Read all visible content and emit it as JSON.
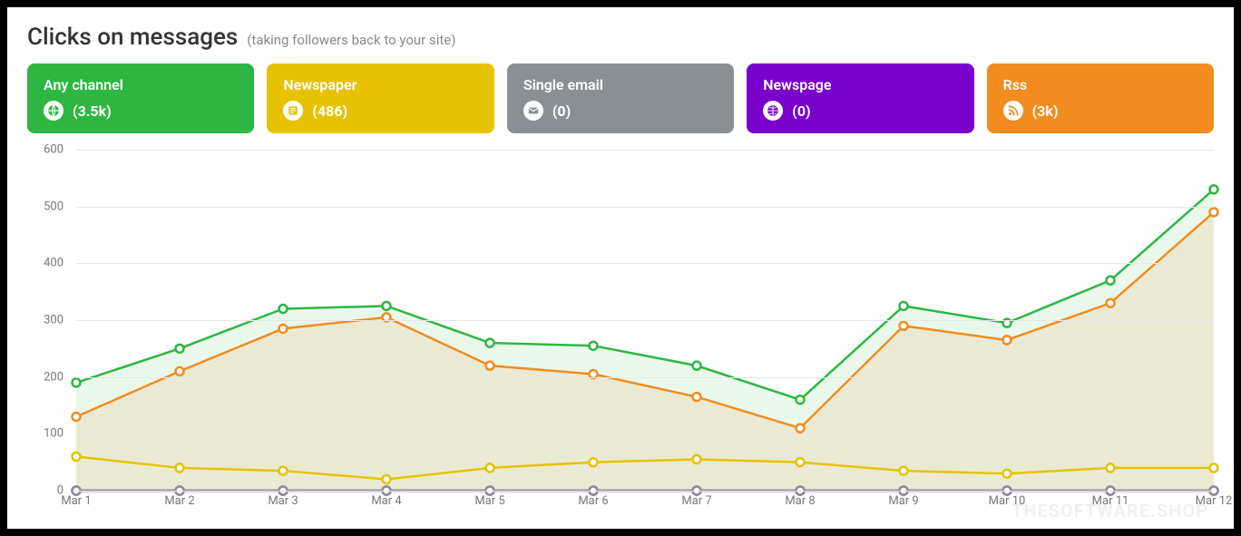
{
  "header": {
    "title": "Clicks on messages",
    "subtitle": "(taking followers back to your site)"
  },
  "cards": [
    {
      "key": "any",
      "label": "Any channel",
      "value": "(3.5k)",
      "color": "green"
    },
    {
      "key": "newspaper",
      "label": "Newspaper",
      "value": "(486)",
      "color": "yellow"
    },
    {
      "key": "email",
      "label": "Single email",
      "value": "(0)",
      "color": "gray"
    },
    {
      "key": "newspage",
      "label": "Newspage",
      "value": "(0)",
      "color": "purple"
    },
    {
      "key": "rss",
      "label": "Rss",
      "value": "(3k)",
      "color": "orange"
    }
  ],
  "watermark": "THESOFTWARE.SHOP",
  "chart_data": {
    "type": "line",
    "title": "Clicks on messages",
    "xlabel": "",
    "ylabel": "",
    "ylim": [
      0,
      600
    ],
    "y_ticks": [
      0,
      100,
      200,
      300,
      400,
      500,
      600
    ],
    "categories": [
      "Mar 1",
      "Mar 2",
      "Mar 3",
      "Mar 4",
      "Mar 5",
      "Mar 6",
      "Mar 7",
      "Mar 8",
      "Mar 9",
      "Mar 10",
      "Mar 11",
      "Mar 12"
    ],
    "series": [
      {
        "name": "Any channel",
        "color": "#2db742",
        "fill": "rgba(45,183,66,0.10)",
        "values": [
          190,
          250,
          320,
          325,
          260,
          255,
          220,
          160,
          325,
          295,
          370,
          530
        ]
      },
      {
        "name": "Rss",
        "color": "#f28c1e",
        "fill": "rgba(242,140,30,0.12)",
        "values": [
          130,
          210,
          285,
          305,
          220,
          205,
          165,
          110,
          290,
          265,
          330,
          490
        ]
      },
      {
        "name": "Newspaper",
        "color": "#e6c200",
        "fill": "none",
        "values": [
          60,
          40,
          35,
          20,
          40,
          50,
          55,
          50,
          35,
          30,
          40,
          40
        ]
      },
      {
        "name": "Newspage",
        "color": "#7a00cc",
        "fill": "none",
        "values": [
          0,
          0,
          0,
          0,
          0,
          0,
          0,
          0,
          0,
          0,
          0,
          0
        ]
      },
      {
        "name": "Single email",
        "color": "#8a8f94",
        "fill": "none",
        "values": [
          0,
          0,
          0,
          0,
          0,
          0,
          0,
          0,
          0,
          0,
          0,
          0
        ]
      }
    ]
  }
}
